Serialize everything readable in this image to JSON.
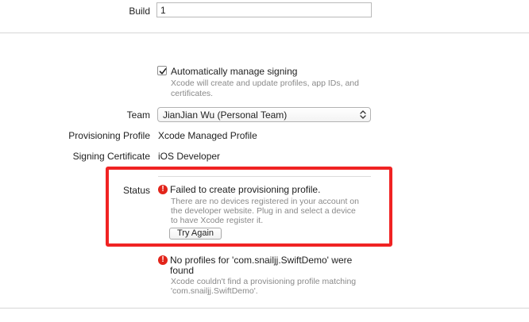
{
  "build": {
    "label": "Build",
    "value": "1"
  },
  "signing": {
    "auto_manage": {
      "checked": true,
      "label": "Automatically manage signing",
      "help_line1": "Xcode will create and update profiles, app IDs, and",
      "help_line2": "certificates."
    },
    "team": {
      "label": "Team",
      "value": "JianJian Wu (Personal Team)"
    },
    "provisioning_profile": {
      "label": "Provisioning Profile",
      "value": "Xcode Managed Profile"
    },
    "signing_certificate": {
      "label": "Signing Certificate",
      "value": "iOS Developer"
    }
  },
  "status": {
    "label": "Status",
    "error1": {
      "title": "Failed to create provisioning profile.",
      "line1": "There are no devices registered in your account on",
      "line2": "the developer website. Plug in and select a device",
      "line3": "to have Xcode register it."
    },
    "try_again_label": "Try Again",
    "error2": {
      "title_line1": "No profiles for 'com.snailjj.SwiftDemo' were",
      "title_line2": "found",
      "line1": "Xcode couldn't find a provisioning profile matching",
      "line2": "'com.snailjj.SwiftDemo'."
    }
  },
  "colors": {
    "error": "#e2241a",
    "highlight_border": "#f02323",
    "help_text": "#8a8a8a"
  },
  "icons": {
    "error": "exclamation-circle-icon",
    "checkmark": "checkmark-icon",
    "popup": "updown-chevron-icon"
  }
}
